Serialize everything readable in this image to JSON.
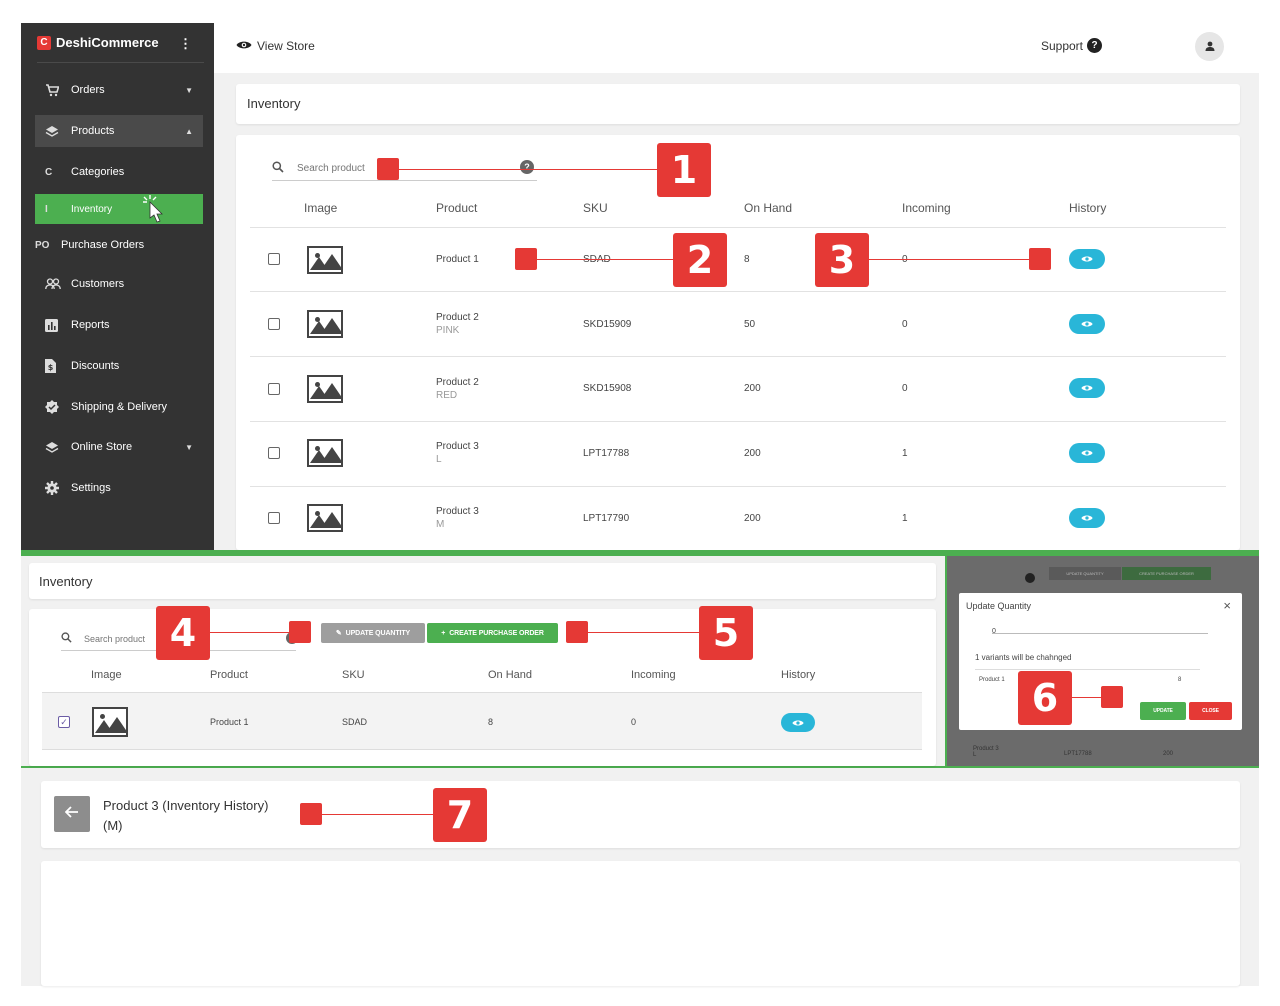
{
  "brand": {
    "logo_letter": "C",
    "name": "DeshiCommerce",
    "menu_icon": "kebab-icon"
  },
  "sidebar": {
    "items": [
      {
        "label": "Orders",
        "icon": "cart-icon"
      },
      {
        "label": "Products",
        "icon": "layers-icon"
      },
      {
        "label": "Categories",
        "icon_text": "C"
      },
      {
        "label": "Inventory",
        "icon_text": "I"
      },
      {
        "label": "Purchase Orders",
        "icon_text": "PO"
      },
      {
        "label": "Customers",
        "icon": "people-icon"
      },
      {
        "label": "Reports",
        "icon": "chart-icon"
      },
      {
        "label": "Discounts",
        "icon": "tag-icon"
      },
      {
        "label": "Shipping & Delivery",
        "icon": "badge-icon"
      },
      {
        "label": "Online Store",
        "icon": "layers-icon"
      },
      {
        "label": "Settings",
        "icon": "gear-icon"
      }
    ]
  },
  "topbar": {
    "view_store": "View Store",
    "support": "Support",
    "help": "?"
  },
  "inventory": {
    "title": "Inventory",
    "search_placeholder": "Search product",
    "columns": [
      "Image",
      "Product",
      "SKU",
      "On Hand",
      "Incoming",
      "History"
    ],
    "rows": [
      {
        "product": "Product 1",
        "variant": "",
        "sku": "SDAD",
        "on_hand": "8",
        "incoming": "0"
      },
      {
        "product": "Product 2",
        "variant": "PINK",
        "sku": "SKD15909",
        "on_hand": "50",
        "incoming": "0"
      },
      {
        "product": "Product 2",
        "variant": "RED",
        "sku": "SKD15908",
        "on_hand": "200",
        "incoming": "0"
      },
      {
        "product": "Product 3",
        "variant": "L",
        "sku": "LPT17788",
        "on_hand": "200",
        "incoming": "1"
      },
      {
        "product": "Product 3",
        "variant": "M",
        "sku": "LPT17790",
        "on_hand": "200",
        "incoming": "1"
      }
    ]
  },
  "panel2": {
    "title": "Inventory",
    "search_placeholder": "Search product",
    "update_quantity": "UPDATE QUANTITY",
    "create_purchase_order": "CREATE PURCHASE ORDER",
    "columns": [
      "Image",
      "Product",
      "SKU",
      "On Hand",
      "Incoming",
      "History"
    ],
    "row": {
      "product": "Product 1",
      "sku": "SDAD",
      "on_hand": "8",
      "incoming": "0"
    }
  },
  "modal": {
    "title": "Update Quantity",
    "input_value": "0",
    "variants_note": "1 variants will be chahnged",
    "row_product": "Product 1",
    "row_value": "8",
    "update": "UPDATE",
    "close": "CLOSE",
    "close_x": "×",
    "bg_update_quantity": "UPDATE QUANTITY",
    "bg_create_purchase_order": "CREATE PURCHASE ORDER",
    "bg_row_product": "Product 3",
    "bg_row_variant": "L",
    "bg_row_sku": "LPT17788",
    "bg_row_on_hand": "200"
  },
  "history": {
    "title_line1": "Product 3 (Inventory History)",
    "title_line2": "(M)"
  },
  "annotations": [
    "1",
    "2",
    "3",
    "4",
    "5",
    "6",
    "7"
  ],
  "colors": {
    "accent_green": "#4caf50",
    "annotation_red": "#e53935",
    "history_blue": "#29b6d8",
    "sidebar_bg": "#333333"
  }
}
